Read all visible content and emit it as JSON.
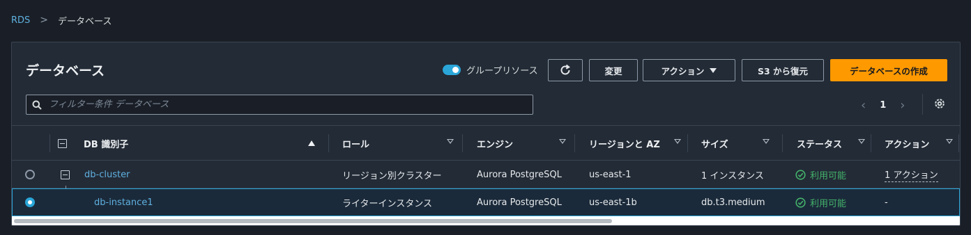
{
  "breadcrumb": {
    "root": "RDS",
    "separator": ">",
    "current": "データベース"
  },
  "panel": {
    "title": "データベース",
    "toggle_label": "グループリソース",
    "toggle_on": true,
    "buttons": {
      "modify": "変更",
      "actions": "アクション",
      "restore_s3": "S3 から復元",
      "create": "データベースの作成"
    },
    "filter_placeholder": "フィルター条件 データベース",
    "pagination": {
      "current_page": "1"
    }
  },
  "table": {
    "headers": {
      "id": "DB 識別子",
      "role": "ロール",
      "engine": "エンジン",
      "region": "リージョンと AZ",
      "size": "サイズ",
      "status": "ステータス",
      "actions": "アクション"
    },
    "rows": [
      {
        "id": "db-cluster",
        "role": "リージョン別クラスター",
        "engine": "Aurora PostgreSQL",
        "region": "us-east-1",
        "size": "1 インスタンス",
        "status": "利用可能",
        "actions": "1 アクション",
        "selected": false
      },
      {
        "id": "db-instance1",
        "role": "ライターインスタンス",
        "engine": "Aurora PostgreSQL",
        "region": "us-east-1b",
        "size": "db.t3.medium",
        "status": "利用可能",
        "actions": "-",
        "selected": true
      }
    ]
  },
  "colors": {
    "accent": "#2aa6d9",
    "primary_button": "#ff9900",
    "status_ok": "#43b26b",
    "link": "#5fb0e0"
  }
}
